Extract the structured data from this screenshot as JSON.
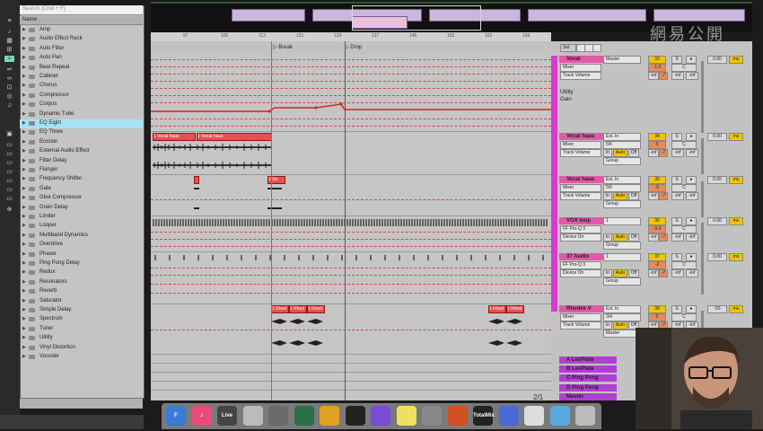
{
  "browser": {
    "search_placeholder": "Search (Cmd + F)",
    "name_header": "Name",
    "items": [
      {
        "label": "Amp"
      },
      {
        "label": "Audio Effect Rack"
      },
      {
        "label": "Auto Filter"
      },
      {
        "label": "Auto Pan"
      },
      {
        "label": "Beat Repeat"
      },
      {
        "label": "Cabinet"
      },
      {
        "label": "Chorus"
      },
      {
        "label": "Compressor"
      },
      {
        "label": "Corpus"
      },
      {
        "label": "Dynamic Tube"
      },
      {
        "label": "EQ Eight"
      },
      {
        "label": "EQ Three"
      },
      {
        "label": "Erosion"
      },
      {
        "label": "External Audio Effect"
      },
      {
        "label": "Filter Delay"
      },
      {
        "label": "Flanger"
      },
      {
        "label": "Frequency Shifter"
      },
      {
        "label": "Gate"
      },
      {
        "label": "Glue Compressor"
      },
      {
        "label": "Grain Delay"
      },
      {
        "label": "Limiter"
      },
      {
        "label": "Looper"
      },
      {
        "label": "Multiband Dynamics"
      },
      {
        "label": "Overdrive"
      },
      {
        "label": "Phaser"
      },
      {
        "label": "Ping Pong Delay"
      },
      {
        "label": "Redux"
      },
      {
        "label": "Resonators"
      },
      {
        "label": "Reverb"
      },
      {
        "label": "Saturator"
      },
      {
        "label": "Simple Delay"
      },
      {
        "label": "Spectrum"
      },
      {
        "label": "Tuner"
      },
      {
        "label": "Utility"
      },
      {
        "label": "Vinyl Distortion"
      },
      {
        "label": "Vocoder"
      }
    ],
    "selected_index": 10
  },
  "ruler": {
    "ticks": [
      "97",
      "105",
      "113",
      "121",
      "129",
      "137",
      "145",
      "153",
      "161",
      "169"
    ],
    "locators": [
      "Break",
      "Drop"
    ]
  },
  "clips": {
    "vocal_haus_1": "1 Vocal haus",
    "vocal_haus_2": "1 Vocal haus",
    "vocal_haus_3": "1 Vo",
    "rhodes": [
      "1 Rhod",
      "1 Rhod",
      "1 Rhod",
      "1 Rhod",
      "1 Rhod"
    ]
  },
  "tracks": [
    {
      "name": "Vocal",
      "input": "Master",
      "mode": "Mixer",
      "auto": "Track Volume",
      "dev1": "Utility",
      "dev2": "Gain",
      "num": "33",
      "vol": "-1.6",
      "pan": "C",
      "peak": "-inf",
      "db": "0.00",
      "ms": "ms"
    },
    {
      "name": "Vocal haus",
      "input": "Ext. In",
      "chan": "5/6",
      "mode": "Mixer",
      "auto": "Track Volume",
      "group": "Group",
      "num": "34",
      "vol": "0",
      "pan": "C",
      "peak": "-inf",
      "db": "0.00",
      "ms": "ms"
    },
    {
      "name": "Vocal haus",
      "input": "Ext. In",
      "chan": "5/6",
      "mode": "Mixer",
      "auto": "Track Volume",
      "group": "Group",
      "num": "35",
      "vol": "-5",
      "pan": "C",
      "peak": "-inf",
      "db": "0.00",
      "ms": "ms"
    },
    {
      "name": "VOX loop",
      "input": "1",
      "mode": "FF Pro-Q 3",
      "auto": "Device On",
      "group": "Group",
      "num": "36",
      "vol": "-3.4",
      "pan": "C",
      "peak": "-inf",
      "db": "0.00",
      "ms": "ms"
    },
    {
      "name": "37 Audio",
      "input": "1",
      "mode": "FF Pro-Q 3",
      "auto": "Device On",
      "group": "Group",
      "num": "37",
      "vol": "-2",
      "pan": "C",
      "peak": "-inf",
      "db": "0.00",
      "ms": "ms"
    },
    {
      "name": "Rhodes V",
      "input": "Ext. In",
      "chan": "3/4",
      "mode": "Mixer",
      "auto": "Track Volume",
      "group": "Master",
      "num": "38",
      "vol": "0",
      "pan": "C",
      "peak": "-inf",
      "db": "-55",
      "ms": "ms"
    }
  ],
  "returns": [
    {
      "name": "A LexPlate"
    },
    {
      "name": "B LexPlate"
    },
    {
      "name": "C Ping Pong"
    },
    {
      "name": "D Ping Pong"
    },
    {
      "name": "Master"
    }
  ],
  "io_labels": {
    "in": "In",
    "auto": "Auto",
    "off": "Off",
    "s": "S",
    "inf": "-inf"
  },
  "page_indicator": "2/1",
  "dock": [
    {
      "name": "Finder",
      "color": "#3a7bd5",
      "label": "F"
    },
    {
      "name": "iTunes",
      "color": "#e84a7a",
      "label": "♫"
    },
    {
      "name": "Live",
      "color": "#444",
      "label": "Live"
    },
    {
      "name": "Reaper",
      "color": "#bbb",
      "label": ""
    },
    {
      "name": "App5",
      "color": "#6a6a6a",
      "label": ""
    },
    {
      "name": "App6",
      "color": "#2c6e4a",
      "label": ""
    },
    {
      "name": "App7",
      "color": "#e0a020",
      "label": ""
    },
    {
      "name": "App8",
      "color": "#222",
      "label": ""
    },
    {
      "name": "App9",
      "color": "#7a4ad8",
      "label": ""
    },
    {
      "name": "Stickies",
      "color": "#f0e060",
      "label": ""
    },
    {
      "name": "Prefs",
      "color": "#888",
      "label": ""
    },
    {
      "name": "App12",
      "color": "#d05020",
      "label": ""
    },
    {
      "name": "TotalMix",
      "color": "#222",
      "label": "TotalMix"
    },
    {
      "name": "App14",
      "color": "#4a6ad8",
      "label": ""
    },
    {
      "name": "App15",
      "color": "#ddd",
      "label": ""
    },
    {
      "name": "Folder",
      "color": "#5aa8e0",
      "label": ""
    },
    {
      "name": "Trash",
      "color": "#bbb",
      "label": ""
    }
  ],
  "watermark": "網易公開"
}
